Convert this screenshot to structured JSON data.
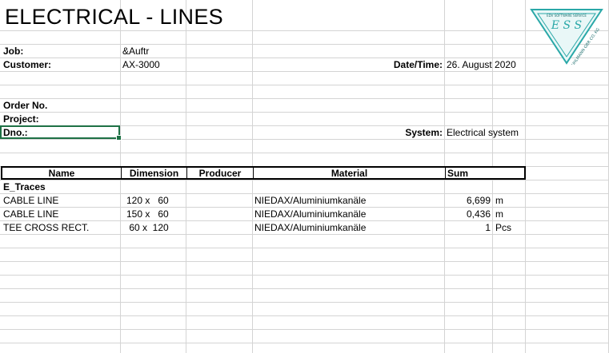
{
  "sheet": {
    "title": "ELECTRICAL - LINES",
    "labels": {
      "job": "Job:",
      "customer": "Customer:",
      "order_no": "Order No.",
      "project": "Project:",
      "dno": "Dno.:",
      "date_time": "Date/Time:",
      "system": "System:"
    },
    "values": {
      "job": "&Auftr",
      "customer": "AX-3000",
      "date_time": "26. August 2020",
      "system": "Electrical system"
    },
    "logo_text": {
      "top": "EDV SOFTWARE SERVICE",
      "middle": "E S S",
      "side": "KUHLMANN GBR CO. KG"
    },
    "table": {
      "headers": [
        "Name",
        "Dimension",
        "Producer",
        "Material",
        "Sum"
      ],
      "group": "E_Traces",
      "rows": [
        {
          "name": "CABLE LINE",
          "dimension": "120 x   60",
          "producer": "",
          "material": "NIEDAX/Aluminiumkanäle",
          "sum": "6,699",
          "unit": "m"
        },
        {
          "name": "CABLE LINE",
          "dimension": "150 x   60",
          "producer": "",
          "material": "NIEDAX/Aluminiumkanäle",
          "sum": "0,436",
          "unit": "m"
        },
        {
          "name": "TEE CROSS RECT.",
          "dimension": " 60 x  120",
          "producer": "",
          "material": "NIEDAX/Aluminiumkanäle",
          "sum": "1",
          "unit": "Pcs"
        }
      ]
    },
    "colors": {
      "gridline": "#d4d4d4",
      "selection": "#1e7145",
      "logo_accent": "#2aa8a8"
    }
  }
}
